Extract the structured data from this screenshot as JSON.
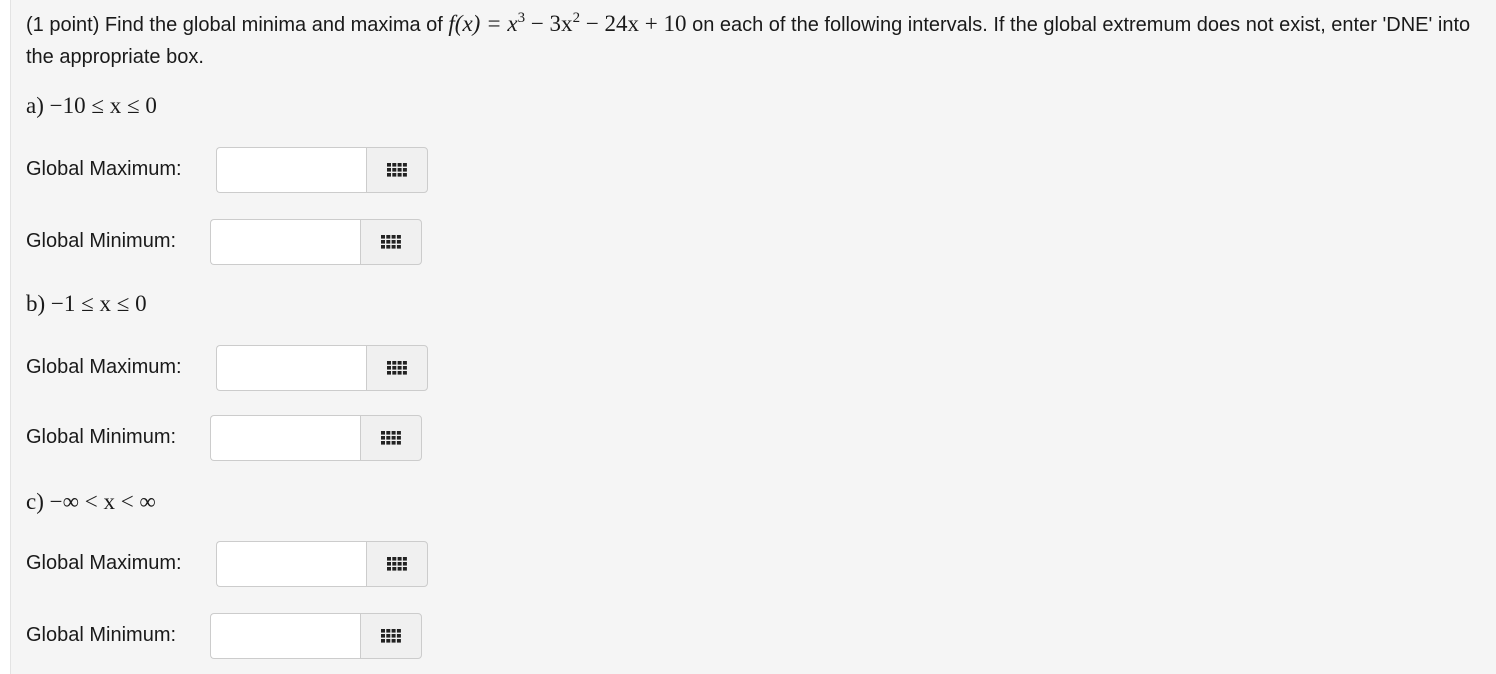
{
  "prompt": {
    "prefix": "(1 point) Find the global minima and maxima of ",
    "function_math": "f(x) = x",
    "exp1": "3",
    "mid1": " − 3x",
    "exp2": "2",
    "mid2": " − 24x + 10",
    "suffix": " on each of the following intervals. If the global extremum does not exist, enter 'DNE' into the appropriate box."
  },
  "parts": [
    {
      "label": "a) −10 ≤ x ≤ 0",
      "max_label": "Global Maximum:",
      "max_value": "",
      "min_label": "Global Minimum:",
      "min_value": ""
    },
    {
      "label": "b) −1 ≤ x ≤ 0",
      "max_label": "Global Maximum:",
      "max_value": "",
      "min_label": "Global Minimum:",
      "min_value": ""
    },
    {
      "label": "c) −∞ < x < ∞",
      "max_label": "Global Maximum:",
      "max_value": "",
      "min_label": "Global Minimum:",
      "min_value": ""
    }
  ],
  "icons": {
    "palette": "grid-icon"
  },
  "colors": {
    "panel_background": "#f5f5f5",
    "input_border": "#cccccc",
    "button_background": "#f0f0f0",
    "icon": "#222222"
  }
}
